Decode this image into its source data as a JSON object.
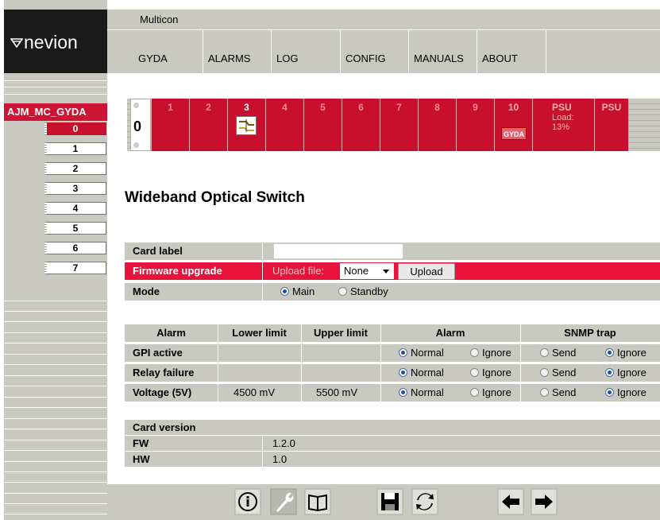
{
  "brand": {
    "logo_text": "nevion",
    "product": "Multicon"
  },
  "menu": [
    "GYDA",
    "ALARMS",
    "LOG",
    "CONFIG",
    "MANUALS",
    "ABOUT"
  ],
  "device": {
    "name": "AJM_MC_GYDA",
    "slots": [
      "0",
      "1",
      "2",
      "3",
      "4",
      "5",
      "6",
      "7"
    ],
    "selected_slot": "0"
  },
  "frame": {
    "frame_number": "0",
    "slots": [
      "1",
      "2",
      "3",
      "4",
      "5",
      "6",
      "7",
      "8",
      "9",
      "10"
    ],
    "selected": "3",
    "slot10_badge": "GYDA",
    "psu1_label": "PSU",
    "psu1_load_label": "Load:",
    "psu1_load_value": "13%",
    "psu2_label": "PSU"
  },
  "page_title": "Wideband Optical Switch",
  "settings": {
    "card_label": {
      "label": "Card label",
      "value": ""
    },
    "firmware": {
      "label": "Firmware upgrade",
      "upload_label": "Upload file:",
      "select_value": "None",
      "upload_button": "Upload"
    },
    "mode": {
      "label": "Mode",
      "options": [
        "Main",
        "Standby"
      ],
      "selected": "Main"
    }
  },
  "alarms": {
    "headers": [
      "Alarm",
      "Lower limit",
      "Upper limit",
      "Alarm",
      "SNMP trap"
    ],
    "option_labels": {
      "normal": "Normal",
      "ignore": "Ignore",
      "send": "Send",
      "ignore2": "Ignore"
    },
    "rows": [
      {
        "name": "GPI active",
        "lower": "",
        "upper": "",
        "alarm": "Normal",
        "snmp": "Ignore"
      },
      {
        "name": "Relay failure",
        "lower": "",
        "upper": "",
        "alarm": "Normal",
        "snmp": "Ignore"
      },
      {
        "name": "Voltage (5V)",
        "lower": "4500 mV",
        "upper": "5500 mV",
        "alarm": "Normal",
        "snmp": "Ignore"
      }
    ]
  },
  "version": {
    "header": "Card version",
    "fw_label": "FW",
    "fw_value": "1.2.0",
    "hw_label": "HW",
    "hw_value": "1.0"
  },
  "toolbar_icons": [
    "info-icon",
    "wrench-icon",
    "book-icon",
    "save-icon",
    "refresh-icon",
    "arrow-left-icon",
    "arrow-right-icon"
  ],
  "colors": {
    "accent_red": "#c8102e",
    "panel_gray": "#c9c9c2"
  }
}
